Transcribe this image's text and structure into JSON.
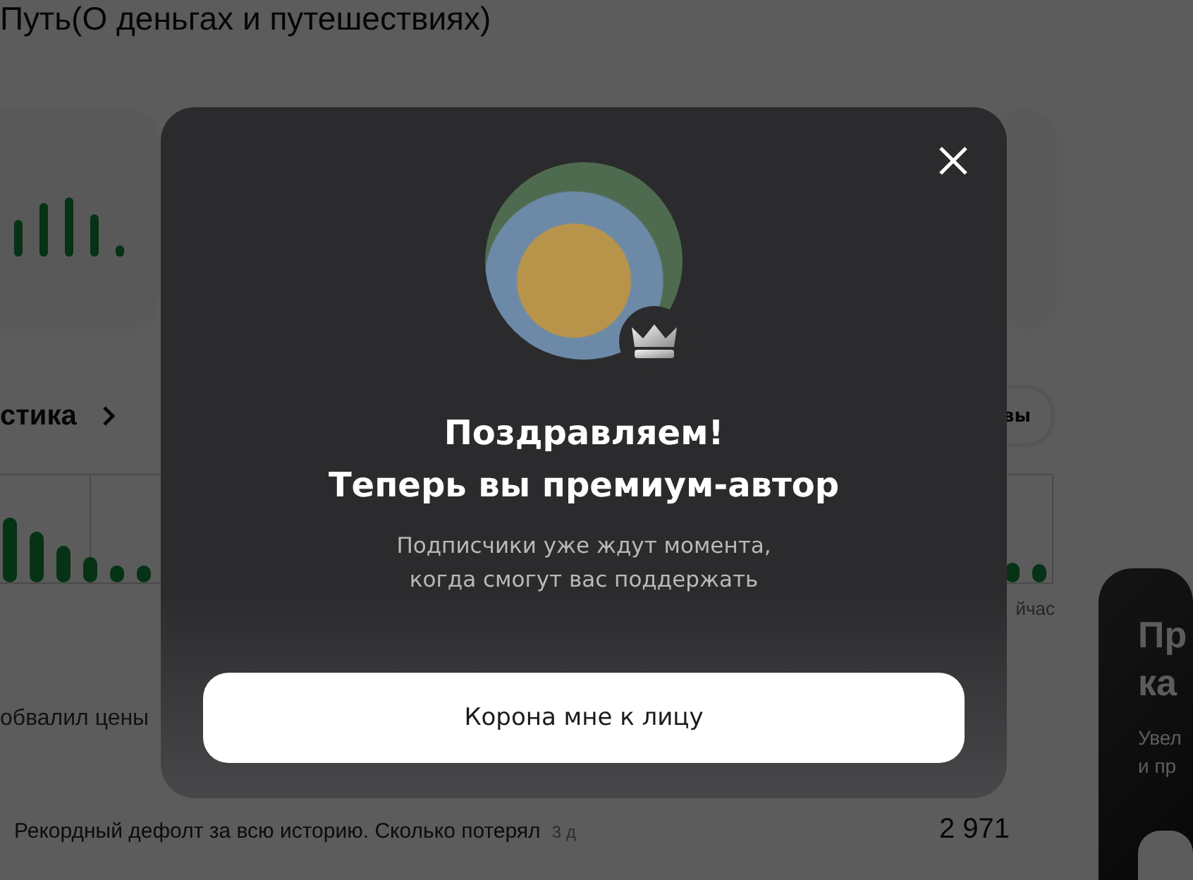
{
  "page": {
    "title": "Путь(О деньгах и путешествиях)"
  },
  "stats": {
    "heading": "стика",
    "pill": "вы",
    "chart_label": "йчас"
  },
  "posts": [
    {
      "title": "обвалил цены"
    },
    {
      "title": "Рекордный дефолт за всю историю. Сколько потерял",
      "age": "3 д",
      "views": "2 971"
    }
  ],
  "promo": {
    "title_lines": [
      "Пр",
      "ка"
    ],
    "text_lines": [
      "Увел",
      "и пр"
    ]
  },
  "modal": {
    "title_lines": [
      "Поздравляем!",
      "Теперь вы премиум-автор"
    ],
    "subtitle_lines": [
      "Подписчики уже ждут момента,",
      "когда смогут вас поддержать"
    ],
    "button": "Корона мне к лицу"
  }
}
